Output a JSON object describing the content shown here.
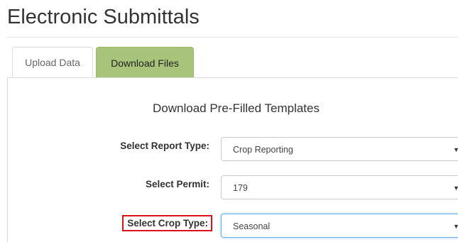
{
  "header": {
    "title": "Electronic Submittals"
  },
  "tabs": [
    {
      "label": "Upload Data",
      "active": false
    },
    {
      "label": "Download Files",
      "active": true
    }
  ],
  "section": {
    "title": "Download Pre-Filled Templates"
  },
  "form": {
    "report_type": {
      "label": "Select Report Type:",
      "value": "Crop Reporting"
    },
    "permit": {
      "label": "Select Permit:",
      "value": "179"
    },
    "crop_type": {
      "label": "Select Crop Type:",
      "value": "Seasonal"
    }
  },
  "icons": {
    "dropdown": "caret-down-icon"
  },
  "colors": {
    "active_tab_bg": "#a7c47a",
    "highlight_box": "#e0101a",
    "focus_border": "#66afe9"
  }
}
